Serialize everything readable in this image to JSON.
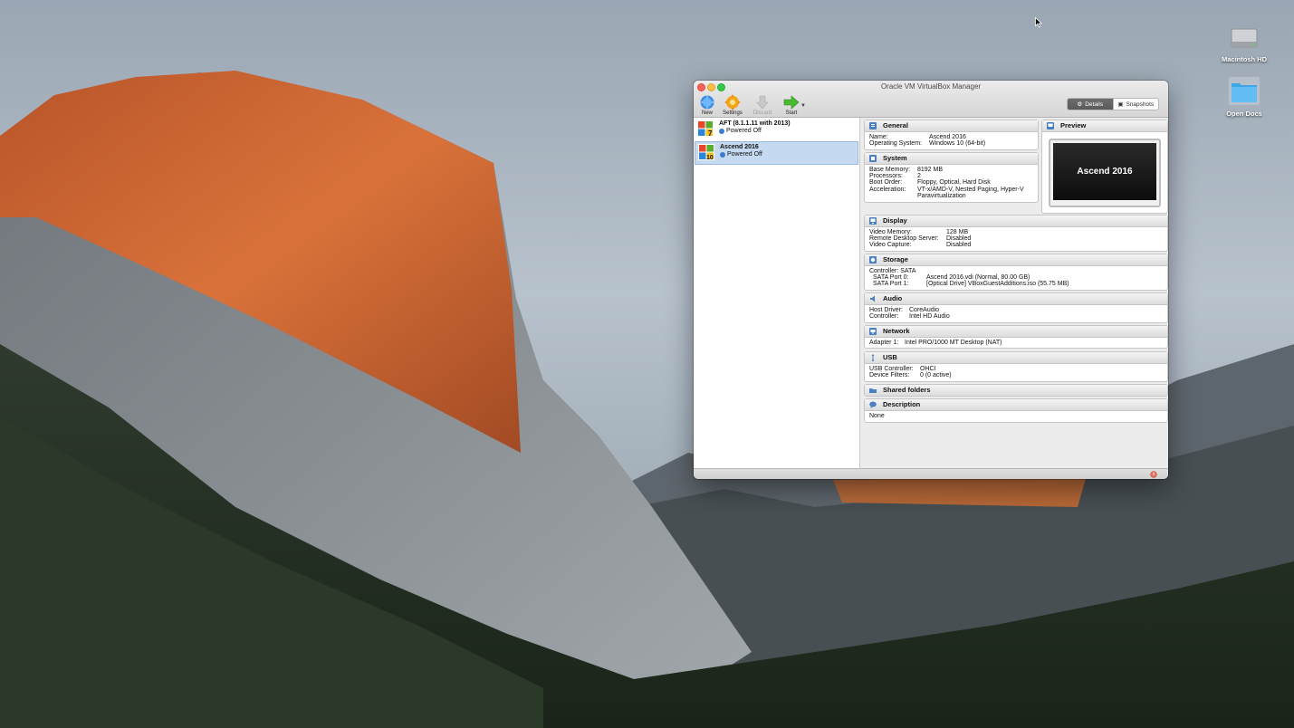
{
  "desktop": {
    "icons": [
      {
        "label": "Macintosh HD",
        "icon": "hard-drive-icon"
      },
      {
        "label": "Open Docs",
        "icon": "folder-icon"
      }
    ]
  },
  "window": {
    "title": "Oracle VM VirtualBox Manager",
    "toolbar": {
      "new_label": "New",
      "settings_label": "Settings",
      "discard_label": "Discard",
      "start_label": "Start"
    },
    "view_toggle": {
      "details_label": "Details",
      "snapshots_label": "Snapshots",
      "active": "details"
    }
  },
  "vm_list": [
    {
      "name": "AFT (8.1.1.11 with 2013)",
      "state": "Powered Off",
      "os_badge": "7",
      "selected": false
    },
    {
      "name": "Ascend 2016",
      "state": "Powered Off",
      "os_badge": "10",
      "selected": true
    }
  ],
  "details": {
    "general": {
      "title": "General",
      "rows": [
        {
          "k": "Name:",
          "v": "Ascend 2016"
        },
        {
          "k": "Operating System:",
          "v": "Windows 10 (64-bit)"
        }
      ]
    },
    "system": {
      "title": "System",
      "rows": [
        {
          "k": "Base Memory:",
          "v": "8192 MB"
        },
        {
          "k": "Processors:",
          "v": "2"
        },
        {
          "k": "Boot Order:",
          "v": "Floppy, Optical, Hard Disk"
        },
        {
          "k": "Acceleration:",
          "v": "VT-x/AMD-V, Nested Paging, Hyper-V"
        },
        {
          "k": "",
          "v": "Paravirtualization"
        }
      ]
    },
    "preview": {
      "title": "Preview",
      "screen_text": "Ascend 2016"
    },
    "display": {
      "title": "Display",
      "rows": [
        {
          "k": "Video Memory:",
          "v": "128 MB"
        },
        {
          "k": "Remote Desktop Server:",
          "v": "Disabled"
        },
        {
          "k": "Video Capture:",
          "v": "Disabled"
        }
      ]
    },
    "storage": {
      "title": "Storage",
      "rows": [
        {
          "k": "Controller: SATA",
          "v": ""
        },
        {
          "k": "  SATA Port 0:",
          "v": "Ascend 2016.vdi (Normal, 80.00 GB)"
        },
        {
          "k": "  SATA Port 1:",
          "v": "[Optical Drive] VBoxGuestAdditions.iso (55.75 MB)"
        }
      ]
    },
    "audio": {
      "title": "Audio",
      "rows": [
        {
          "k": "Host Driver:",
          "v": "CoreAudio"
        },
        {
          "k": "Controller:",
          "v": "Intel HD Audio"
        }
      ]
    },
    "network": {
      "title": "Network",
      "rows": [
        {
          "k": "Adapter 1:",
          "v": "Intel PRO/1000 MT Desktop (NAT)"
        }
      ]
    },
    "usb": {
      "title": "USB",
      "rows": [
        {
          "k": "USB Controller:",
          "v": "OHCI"
        },
        {
          "k": "Device Filters:",
          "v": "0 (0 active)"
        }
      ]
    },
    "shared_folders": {
      "title": "Shared folders"
    },
    "description": {
      "title": "Description",
      "text": "None"
    }
  },
  "colors": {
    "selection": "#c5d9f0",
    "section_icon": "#4a7fc1"
  }
}
